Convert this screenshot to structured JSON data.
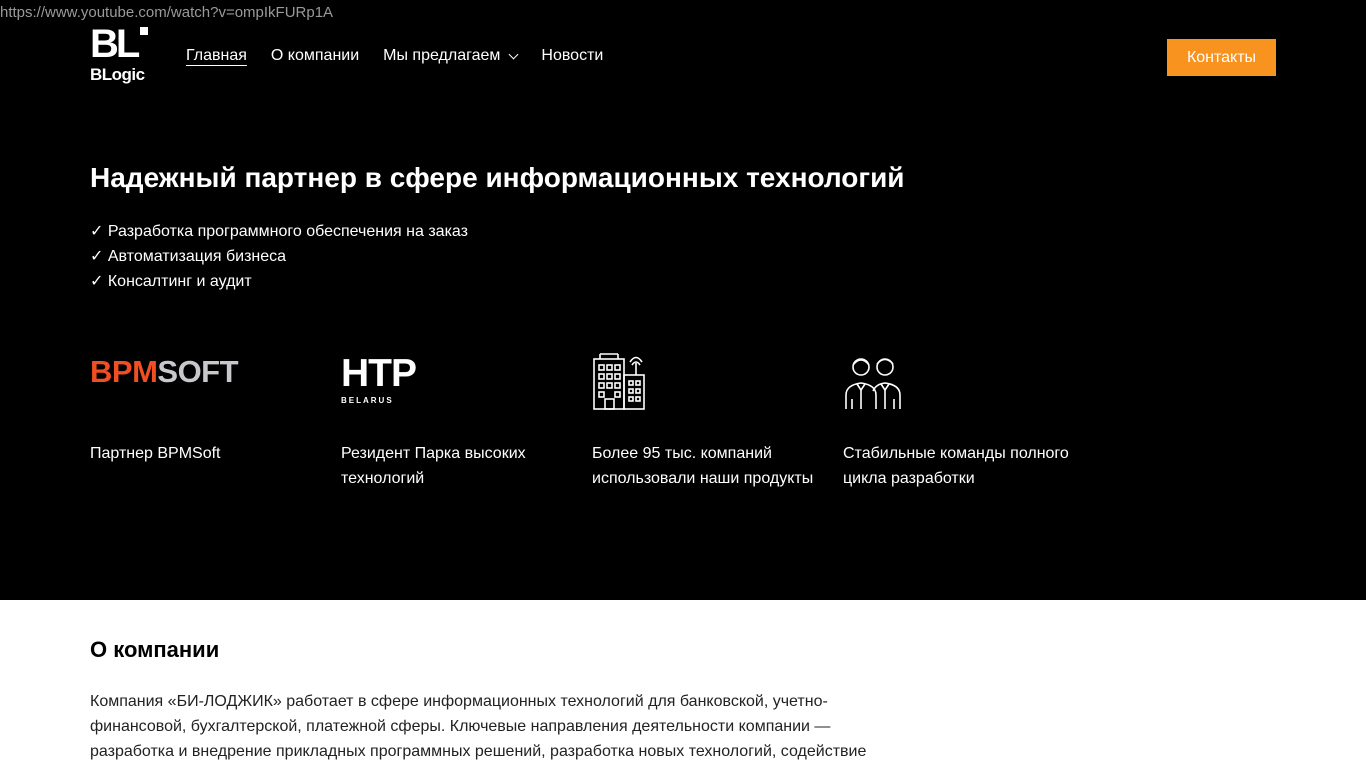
{
  "overlay": {
    "url": "https://www.youtube.com/watch?v=ompIkFURp1A"
  },
  "header": {
    "logo_mark": "BL",
    "logo_word": "BLogic",
    "nav": [
      {
        "label": "Главная",
        "active": true
      },
      {
        "label": "О компании"
      },
      {
        "label": "Мы предлагаем",
        "has_dropdown": true
      },
      {
        "label": "Новости"
      }
    ],
    "contact_label": "Контакты",
    "accent_color": "#f7931e"
  },
  "hero": {
    "title": "Надежный партнер в сфере информационных технологий",
    "bullets": [
      "✓ Разработка программного обеспечения на заказ",
      "✓ Автоматизация бизнеса",
      "✓ Консалтинг и аудит"
    ],
    "features": [
      {
        "logo_part1": "BPM",
        "logo_part2": "SOFT",
        "text": "Партнер BPMSoft"
      },
      {
        "logo_big": "HTP",
        "logo_small": "BELARUS",
        "text": "Резидент Парка высоких технологий"
      },
      {
        "icon": "office-building-icon",
        "text": "Более 95 тыс. компаний использовали наши продукты"
      },
      {
        "icon": "team-people-icon",
        "text": "Стабильные команды полного цикла разработки"
      }
    ]
  },
  "about": {
    "title": "О компании",
    "text": "Компания «БИ-ЛОДЖИК» работает в сфере информационных технологий для банковской, учетно-финансовой, бухгалтерской, платежной сферы. Ключевые направления деятельности компании — разработка и внедрение прикладных программных решений, разработка новых технологий, содействие"
  }
}
